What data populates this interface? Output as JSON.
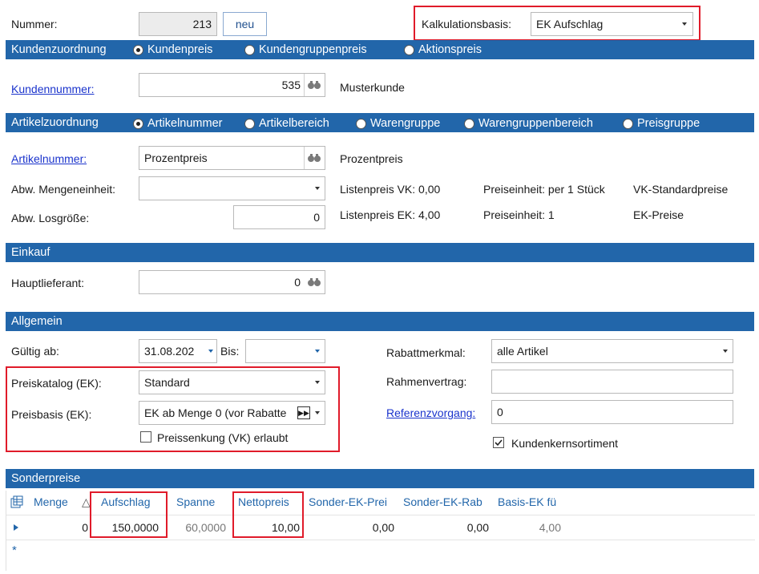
{
  "header": {
    "nummer_label": "Nummer:",
    "nummer_value": "213",
    "neu_label": "neu",
    "kalkulationsbasis_label": "Kalkulationsbasis:",
    "kalkulationsbasis_value": "EK Aufschlag"
  },
  "kundenzuordnung": {
    "title": "Kundenzuordnung",
    "options": [
      "Kundenpreis",
      "Kundengruppenpreis",
      "Aktionspreis"
    ],
    "selected": "Kundenpreis",
    "kundennummer_label": "Kundennummer:",
    "kundennummer_value": "535",
    "kunde_name": "Musterkunde"
  },
  "artikelzuordnung": {
    "title": "Artikelzuordnung",
    "options": [
      "Artikelnummer",
      "Artikelbereich",
      "Warengruppe",
      "Warengruppenbereich",
      "Preisgruppe"
    ],
    "selected": "Artikelnummer",
    "artikelnummer_label": "Artikelnummer:",
    "artikelnummer_value": "Prozentpreis",
    "artikel_name": "Prozentpreis",
    "mengeneinheit_label": "Abw. Mengeneinheit:",
    "mengeneinheit_value": "",
    "losgroesse_label": "Abw. Losgröße:",
    "losgroesse_value": "0",
    "listenpreis_vk": "Listenpreis VK:  0,00",
    "listenpreis_ek": "Listenpreis EK:  4,00",
    "preiseinheit_vk": "Preiseinheit: per 1 Stück",
    "preiseinheit_ek": "Preiseinheit: 1",
    "vk_standardpreise": "VK-Standardpreise",
    "ek_preise": "EK-Preise"
  },
  "einkauf": {
    "title": "Einkauf",
    "hauptlieferant_label": "Hauptlieferant:",
    "hauptlieferant_value": "0"
  },
  "allgemein": {
    "title": "Allgemein",
    "gueltig_ab_label": "Gültig ab:",
    "gueltig_ab_value": "31.08.202",
    "bis_label": "Bis:",
    "bis_value": "",
    "preiskatalog_label": "Preiskatalog (EK):",
    "preiskatalog_value": "Standard",
    "preisbasis_label": "Preisbasis (EK):",
    "preisbasis_value": "EK ab Menge 0 (vor Rabatte",
    "preissenkung_label": "Preissenkung (VK) erlaubt",
    "preissenkung_checked": false,
    "rabattmerkmal_label": "Rabattmerkmal:",
    "rabattmerkmal_value": "alle Artikel",
    "rahmenvertrag_label": "Rahmenvertrag:",
    "rahmenvertrag_value": "",
    "referenzvorgang_label": "Referenzvorgang:",
    "referenzvorgang_value": "0",
    "kundenkernsortiment_label": "Kundenkernsortiment",
    "kundenkernsortiment_checked": true
  },
  "sonderpreise": {
    "title": "Sonderpreise",
    "columns": [
      "Menge",
      "△",
      "Aufschlag",
      "Spanne",
      "Nettopreis",
      "Sonder-EK-Prei",
      "Sonder-EK-Rab",
      "Basis-EK fü"
    ],
    "row": [
      "0",
      "",
      "150,0000",
      "60,0000",
      "10,00",
      "0,00",
      "0,00",
      "4,00"
    ],
    "new_row_marker": "*"
  },
  "colors": {
    "band": "#2266aa",
    "highlight": "#e01b2a",
    "link": "#1a33cc"
  }
}
